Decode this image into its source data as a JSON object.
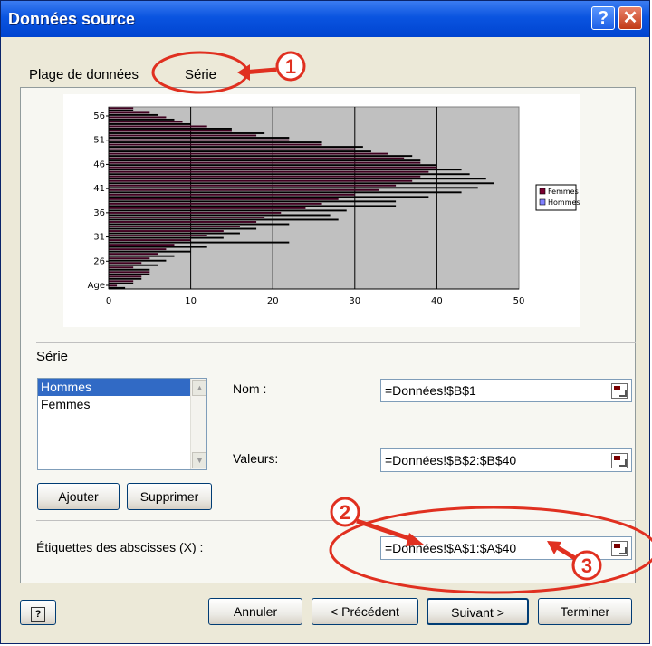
{
  "window": {
    "title": "Données source"
  },
  "tabs": [
    {
      "label": "Plage de données"
    },
    {
      "label": "Série"
    }
  ],
  "chart_data": {
    "type": "bar",
    "orientation": "horizontal",
    "xlim": [
      0,
      50
    ],
    "x_ticks": [
      "0",
      "10",
      "20",
      "30",
      "40",
      "50"
    ],
    "y_tick_labels": [
      "Age",
      "26",
      "31",
      "36",
      "41",
      "46",
      "51",
      "56"
    ],
    "legend": [
      "Femmes",
      "Hommes"
    ],
    "legend_position": "right",
    "plot_background": "#c0c0c0",
    "series": [
      {
        "name": "Femmes",
        "values": [
          1,
          3,
          4,
          5,
          3,
          4,
          5,
          6,
          7,
          8,
          10,
          12,
          14,
          16,
          18,
          19,
          21,
          24,
          26,
          28,
          30,
          33,
          35,
          37,
          38,
          39,
          40,
          38,
          36,
          34,
          30,
          26,
          22,
          18,
          15,
          12,
          9,
          7,
          5,
          3
        ]
      },
      {
        "name": "Hommes",
        "values": [
          2,
          3,
          4,
          5,
          5,
          6,
          7,
          8,
          10,
          12,
          22,
          14,
          16,
          18,
          22,
          28,
          27,
          29,
          35,
          35,
          39,
          43,
          45,
          47,
          46,
          44,
          43,
          40,
          38,
          37,
          32,
          31,
          26,
          22,
          19,
          15,
          10,
          8,
          6,
          3
        ]
      }
    ]
  },
  "series_section": {
    "label": "Série",
    "items": [
      "Hommes",
      "Femmes"
    ],
    "add_label": "Ajouter",
    "remove_label": "Supprimer",
    "name_label": "Nom :",
    "name_value": "=Données!$B$1",
    "values_label": "Valeurs:",
    "values_value": "=Données!$B$2:$B$40"
  },
  "categories": {
    "label": "Étiquettes des abscisses (X) :",
    "value": "=Données!$A$1:$A$40"
  },
  "annotations": [
    "1",
    "2",
    "3"
  ],
  "footer": {
    "help": "?",
    "cancel": "Annuler",
    "back": "< Précédent",
    "next": "Suivant >",
    "finish": "Terminer"
  }
}
